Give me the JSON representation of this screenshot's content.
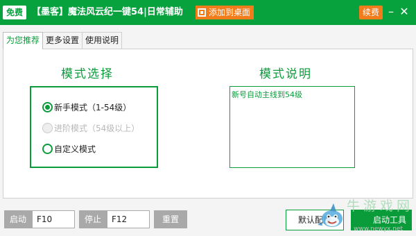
{
  "titlebar": {
    "badge": "免费",
    "title": "【墨客】魔法风云纪一键54|日常辅助",
    "add_desktop": "添加到桌面",
    "renew": "续费",
    "minimize_glyph": "–",
    "close_glyph": "✕"
  },
  "tabs": [
    {
      "label": "为您推荐",
      "active": true
    },
    {
      "label": "更多设置",
      "active": false
    },
    {
      "label": "使用说明",
      "active": false
    }
  ],
  "mode_select": {
    "heading": "模式选择",
    "options": [
      {
        "label": "新手模式（1-54级）",
        "checked": true,
        "disabled": false
      },
      {
        "label": "进阶模式（54级以上）",
        "checked": false,
        "disabled": true
      },
      {
        "label": "自定义模式",
        "checked": false,
        "disabled": false
      }
    ]
  },
  "mode_desc": {
    "heading": "模式说明",
    "text": "新号自动主线到54级"
  },
  "bottom": {
    "start_label": "启动",
    "start_hotkey": "F10",
    "stop_label": "停止",
    "stop_hotkey": "F12",
    "reset_label": "重置",
    "default_config": "默认配置",
    "launch_tool": "启动工具"
  },
  "watermark": {
    "text": "牛游戏网",
    "url": "www.newyx.net"
  },
  "colors": {
    "brand_green": "#07a23e",
    "accent_orange": "#f07c1c",
    "button_gray": "#a9a9a9"
  }
}
